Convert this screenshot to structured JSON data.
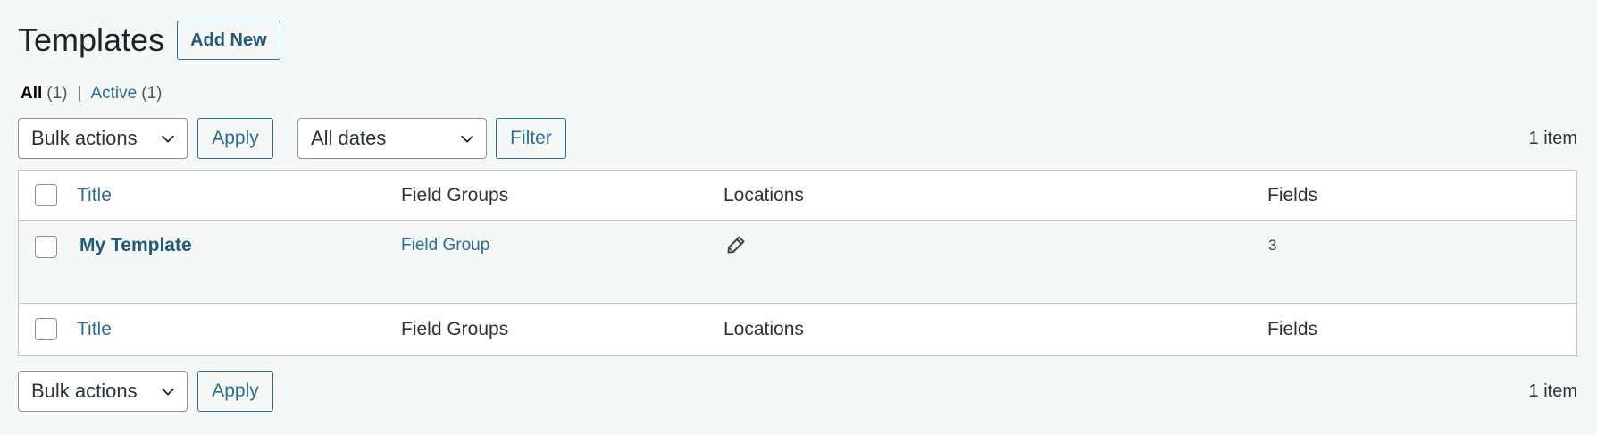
{
  "header": {
    "title": "Templates",
    "add_new_label": "Add New"
  },
  "views": {
    "all_label": "All",
    "all_count": "(1)",
    "separator": "|",
    "active_label": "Active",
    "active_count": "(1)"
  },
  "top_nav": {
    "bulk_actions": "Bulk actions",
    "apply_label": "Apply",
    "dates": "All dates",
    "filter_label": "Filter",
    "item_count": "1 item"
  },
  "table": {
    "columns": [
      "Title",
      "Field Groups",
      "Locations",
      "Fields"
    ],
    "rows": [
      {
        "title": "My Template",
        "field_groups": "Field Group",
        "location_icon": "pencil-icon",
        "fields": "3"
      }
    ]
  },
  "bottom_nav": {
    "bulk_actions": "Bulk actions",
    "apply_label": "Apply",
    "item_count": "1 item"
  },
  "colors": {
    "link": "#2c6f91",
    "border": "#c3c4c7",
    "background": "#f6f7f7"
  }
}
